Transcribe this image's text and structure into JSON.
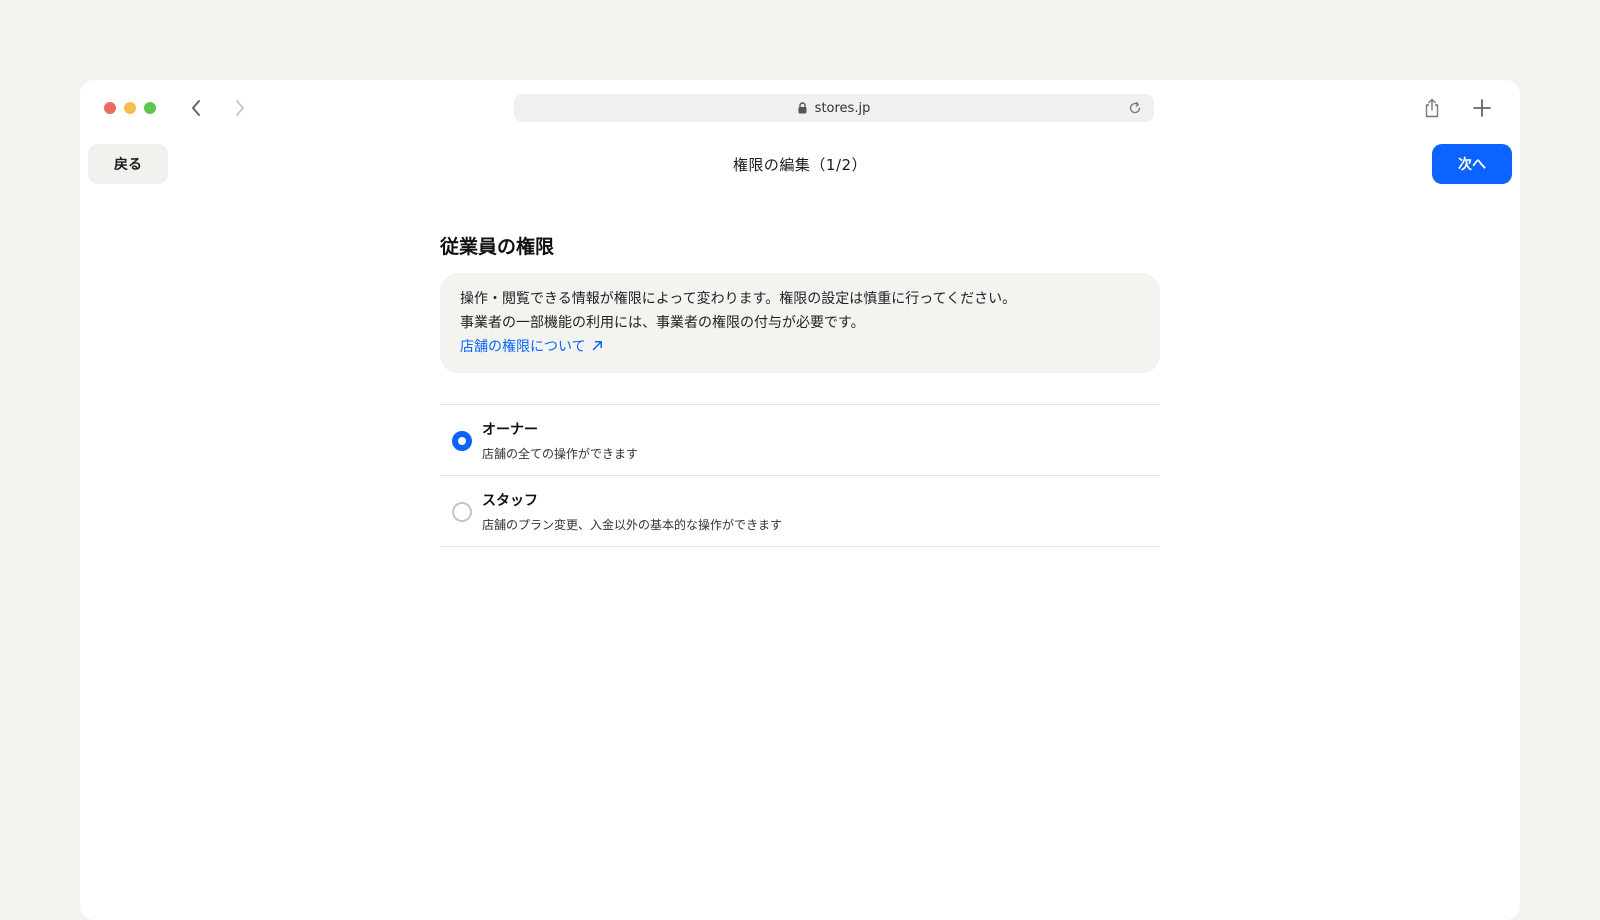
{
  "browser": {
    "url": "stores.jp",
    "icons": {
      "back": "chevron-left-icon",
      "forward": "chevron-right-icon",
      "lock": "lock-icon",
      "reload": "reload-icon",
      "share": "share-icon",
      "new_tab": "plus-icon"
    }
  },
  "header": {
    "back_label": "戻る",
    "title": "権限の編集（1/2）",
    "next_label": "次へ"
  },
  "section": {
    "title": "従業員の権限",
    "info_line1": "操作・閲覧できる情報が権限によって変わります。権限の設定は慎重に行ってください。",
    "info_line2": "事業者の一部機能の利用には、事業者の権限の付与が必要です。",
    "link_label": "店舗の権限について",
    "link_icon": "external-link-arrow-icon"
  },
  "options": [
    {
      "title": "オーナー",
      "description": "店舗の全ての操作ができます",
      "selected": true
    },
    {
      "title": "スタッフ",
      "description": "店舗のプラン変更、入金以外の基本的な操作ができます",
      "selected": false
    }
  ],
  "colors": {
    "accent": "#0b64ff",
    "page_background": "#f3f3ef",
    "info_background": "#f3f3ef"
  }
}
